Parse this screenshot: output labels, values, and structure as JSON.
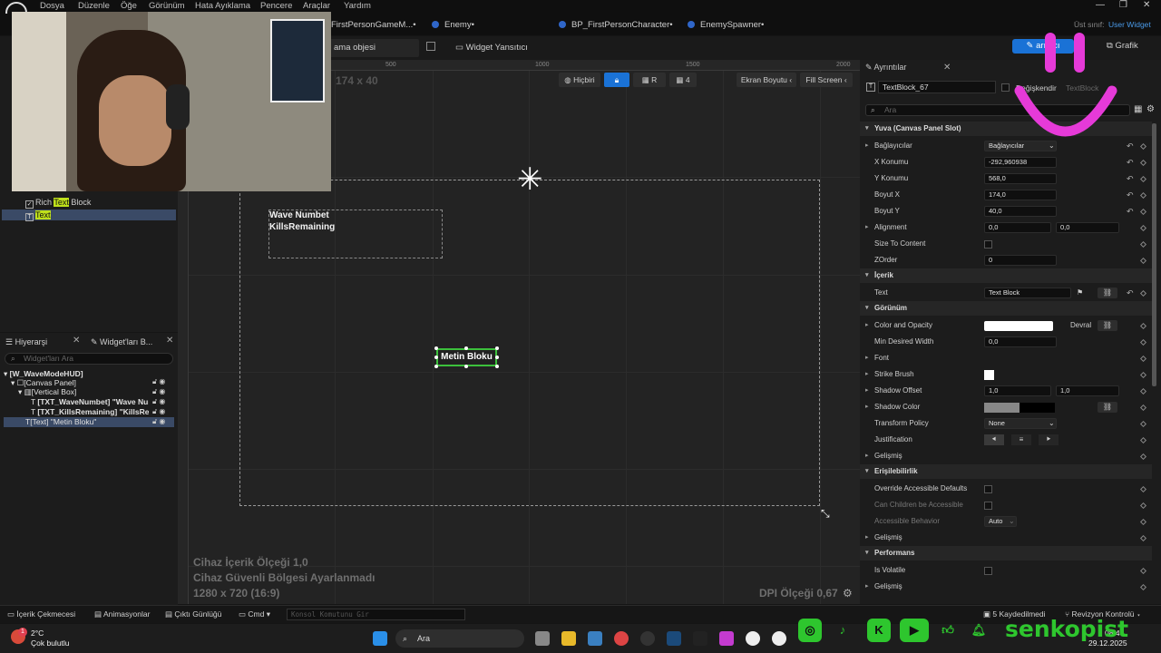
{
  "menu": [
    "Dosya",
    "Düzenle",
    "Öğe",
    "Görünüm",
    "Hata Ayıklama",
    "Pencere",
    "Araçlar",
    "Yardım"
  ],
  "tabs": [
    {
      "label": "FirstPersonGameM...•"
    },
    {
      "label": "Enemy•"
    },
    {
      "label": "BP_FirstPersonCharacter•"
    },
    {
      "label": "EnemySpawner•"
    }
  ],
  "parent_class": {
    "label": "Üst sınıf:",
    "value": "User Widget"
  },
  "toolbar": {
    "selection_drop": "ama objesi seçilmedi",
    "widget_reflector": "Widget Yansıtıcı",
    "designer_btn": "arımcı",
    "graph_btn": "Grafik"
  },
  "palette_tree": [
    {
      "pre": "Rich ",
      "hl": "Text",
      "post": " Block",
      "sel": false
    },
    {
      "pre": "",
      "hl": "Text",
      "post": "",
      "sel": true
    }
  ],
  "hierarchy": {
    "tab1": "Hiyerarşi",
    "tab2": "Widget'ları B...",
    "search_placeholder": "Widget'ları Ara",
    "rows": [
      {
        "text": "[W_WaveModeHUD]",
        "indent": 0,
        "bold": true,
        "sel": false
      },
      {
        "text": "[Canvas Panel]",
        "indent": 1,
        "bold": false,
        "sel": false
      },
      {
        "text": "[Vertical Box]",
        "indent": 2,
        "bold": false,
        "sel": false
      },
      {
        "text": "[TXT_WaveNumbet] \"Wave Num",
        "indent": 3,
        "bold": true,
        "sel": false
      },
      {
        "text": "[TXT_KillsRemaining] \"KillsRema",
        "indent": 3,
        "bold": true,
        "sel": false
      },
      {
        "text": "[Text] \"Metin Bloku\"",
        "indent": 2,
        "bold": false,
        "sel": true
      }
    ]
  },
  "canvas": {
    "size_readout": "174 x 40",
    "ruler_ticks": [
      "500",
      "1000",
      "1500",
      "2000"
    ],
    "none_btn": "Hiçbiri",
    "grid_val": "4",
    "r_label": "R",
    "screen_size": "Ekran Boyutu",
    "fill_screen": "Fill Screen",
    "wave_text": "Wave Numbet",
    "kills_text": "KillsRemaining",
    "textblock_text": "Metin Bloku",
    "info_scale": "Cihaz İçerik Ölçeği 1,0",
    "info_safe": "Cihaz Güvenli Bölgesi Ayarlanmadı",
    "info_res": "1280 x 720 (16:9)",
    "dpi": "DPI Ölçeği 0,67"
  },
  "details": {
    "tab": "Ayrıntılar",
    "name": "TextBlock_67",
    "is_variable": "Değişkendir",
    "class_hint": "TextBlock",
    "search_placeholder": "Ara",
    "rows": [
      {
        "kind": "sect",
        "label": "Yuva (Canvas Panel Slot)"
      },
      {
        "kind": "row",
        "label": "Bağlayıcılar",
        "arrow": true,
        "f1": "Bağlayıcılar",
        "drop": true,
        "reset": true
      },
      {
        "kind": "row",
        "label": "X Konumu",
        "f1": "-292,960938",
        "reset": true
      },
      {
        "kind": "row",
        "label": "Y Konumu",
        "f1": "568,0",
        "reset": true
      },
      {
        "kind": "row",
        "label": "Boyut X",
        "f1": "174,0",
        "reset": true
      },
      {
        "kind": "row",
        "label": "Boyut Y",
        "f1": "40,0",
        "reset": true
      },
      {
        "kind": "row",
        "label": "Alignment",
        "arrow": true,
        "f1": "0,0",
        "f2": "0,0"
      },
      {
        "kind": "row",
        "label": "Size To Content",
        "cb": true
      },
      {
        "kind": "row",
        "label": "ZOrder",
        "f1": "0"
      },
      {
        "kind": "sect",
        "label": "İçerik"
      },
      {
        "kind": "row",
        "label": "Text",
        "f1": "Text Block",
        "flag": true,
        "reset": true
      },
      {
        "kind": "sect",
        "label": "Görünüm"
      },
      {
        "kind": "row",
        "label": "Color and Opacity",
        "arrow": true,
        "white": true,
        "extra": "Devral"
      },
      {
        "kind": "row",
        "label": "Min Desired Width",
        "f1": "0,0"
      },
      {
        "kind": "row",
        "label": "Font",
        "arrow": true
      },
      {
        "kind": "row",
        "label": "Strike Brush",
        "arrow": true,
        "whitebox": true
      },
      {
        "kind": "row",
        "label": "Shadow Offset",
        "arrow": true,
        "f1": "1,0",
        "f2": "1,0"
      },
      {
        "kind": "row",
        "label": "Shadow Color",
        "arrow": true,
        "checker": true
      },
      {
        "kind": "row",
        "label": "Transform Policy",
        "f1": "None",
        "drop": true
      },
      {
        "kind": "row",
        "label": "Justification",
        "justify": true
      },
      {
        "kind": "row",
        "label": "Gelişmiş",
        "arrow": true
      },
      {
        "kind": "sect",
        "label": "Erişilebilirlik"
      },
      {
        "kind": "row",
        "label": "Override Accessible Defaults",
        "cb": true
      },
      {
        "kind": "row",
        "label": "Can Children be Accessible",
        "cb": true,
        "dim": true
      },
      {
        "kind": "row",
        "label": "Accessible Behavior",
        "f1": "Auto",
        "drop": true,
        "dim": true
      },
      {
        "kind": "row",
        "label": "Gelişmiş",
        "arrow": true
      },
      {
        "kind": "sect",
        "label": "Performans"
      },
      {
        "kind": "row",
        "label": "Is Volatile",
        "cb": true
      },
      {
        "kind": "row",
        "label": "Gelişmiş",
        "arrow": true
      }
    ]
  },
  "statusbar": {
    "content_drawer": "İçerik Çekmecesi",
    "animations": "Animasyonlar",
    "output_log": "Çıktı Günlüğü",
    "cmd": "Cmd",
    "console_placeholder": "Konsol Komutunu Gir",
    "unsaved": "5 Kaydedilmedi",
    "revision": "Revizyon Kontrolü"
  },
  "taskbar": {
    "weather_temp": "2°C",
    "weather_desc": "Çok bulutlu",
    "search": "Ara",
    "time": "08:47",
    "date": "29.12.2025",
    "badge": "1"
  },
  "overlay": {
    "brand": "senkopist"
  },
  "colors": {
    "accent": "#1a72d6",
    "selection_green": "#3cc03c",
    "highlight": "#bfe01a",
    "overlay_pink": "#e63ad8",
    "social_green": "#2ec62e"
  }
}
